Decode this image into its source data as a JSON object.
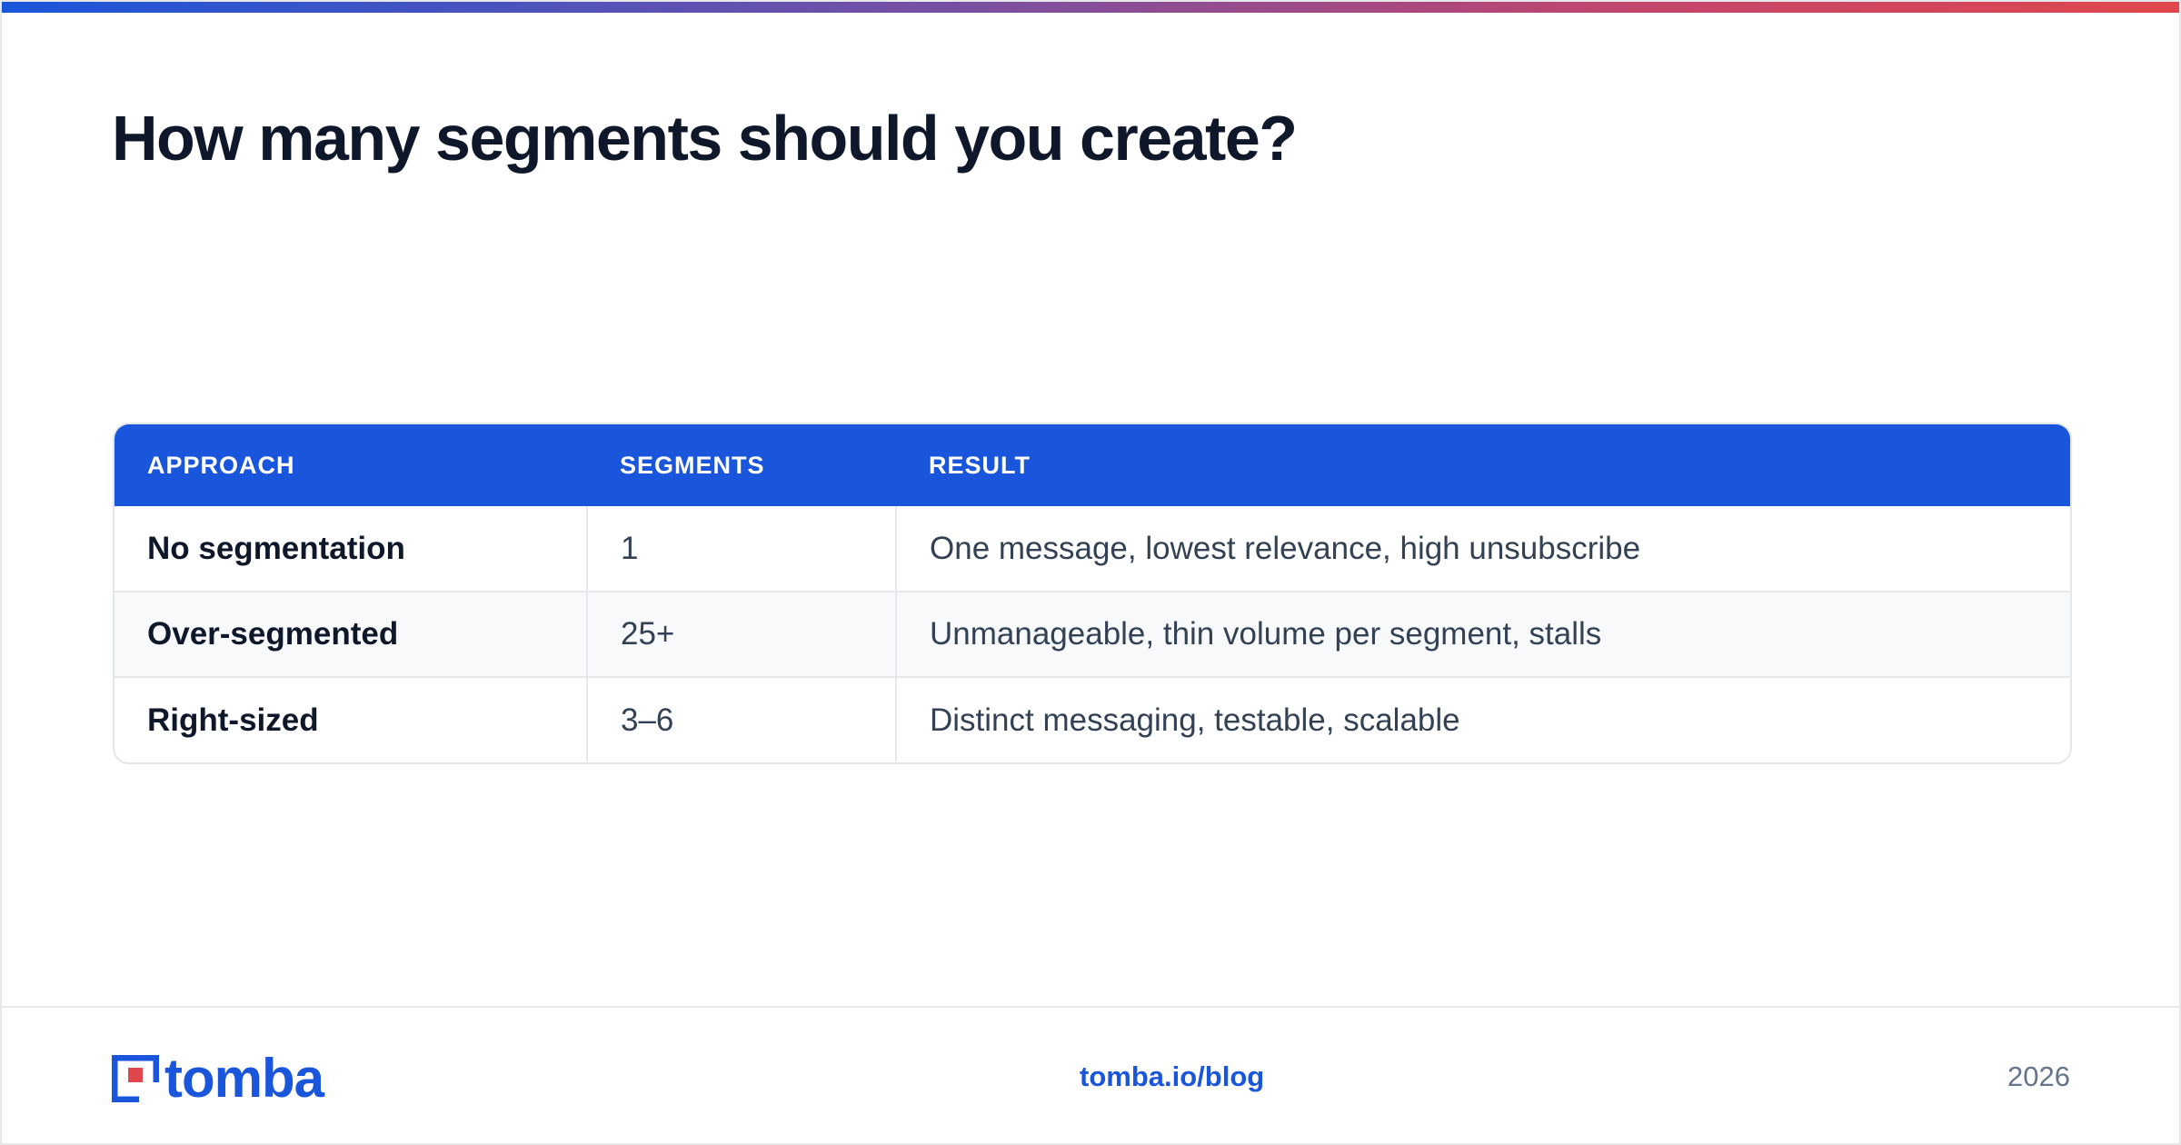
{
  "slide": {
    "title": "How many segments should you create?"
  },
  "table": {
    "headers": [
      "APPROACH",
      "SEGMENTS",
      "RESULT"
    ],
    "rows": [
      {
        "approach": "No segmentation",
        "segments": "1",
        "result": "One message, lowest relevance, high unsubscribe"
      },
      {
        "approach": "Over-segmented",
        "segments": "25+",
        "result": "Unmanageable, thin volume per segment, stalls"
      },
      {
        "approach": "Right-sized",
        "segments": "3–6",
        "result": "Distinct messaging, testable, scalable"
      }
    ]
  },
  "footer": {
    "logo_text": "tomba",
    "link": "tomba.io/blog",
    "year": "2026"
  },
  "colors": {
    "brand_blue": "#1a56db",
    "brand_red": "#e0474c",
    "title": "#0f172a"
  }
}
